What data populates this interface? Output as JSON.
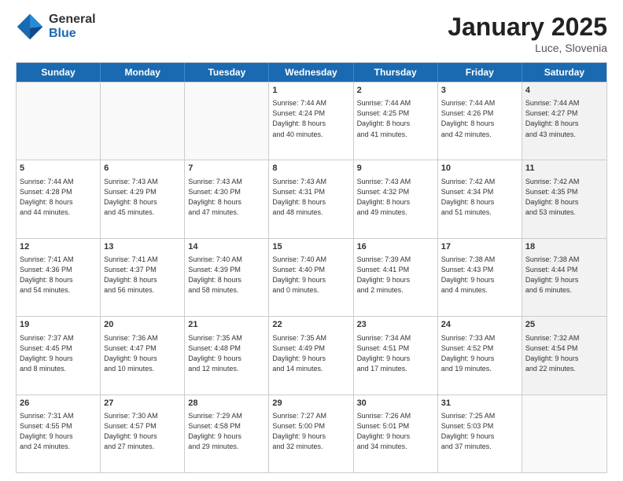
{
  "logo": {
    "general": "General",
    "blue": "Blue"
  },
  "title": {
    "month": "January 2025",
    "location": "Luce, Slovenia"
  },
  "header": {
    "days": [
      "Sunday",
      "Monday",
      "Tuesday",
      "Wednesday",
      "Thursday",
      "Friday",
      "Saturday"
    ]
  },
  "rows": [
    [
      {
        "day": "",
        "text": "",
        "empty": true
      },
      {
        "day": "",
        "text": "",
        "empty": true
      },
      {
        "day": "",
        "text": "",
        "empty": true
      },
      {
        "day": "1",
        "text": "Sunrise: 7:44 AM\nSunset: 4:24 PM\nDaylight: 8 hours\nand 40 minutes.",
        "empty": false
      },
      {
        "day": "2",
        "text": "Sunrise: 7:44 AM\nSunset: 4:25 PM\nDaylight: 8 hours\nand 41 minutes.",
        "empty": false
      },
      {
        "day": "3",
        "text": "Sunrise: 7:44 AM\nSunset: 4:26 PM\nDaylight: 8 hours\nand 42 minutes.",
        "empty": false
      },
      {
        "day": "4",
        "text": "Sunrise: 7:44 AM\nSunset: 4:27 PM\nDaylight: 8 hours\nand 43 minutes.",
        "empty": false,
        "shaded": true
      }
    ],
    [
      {
        "day": "5",
        "text": "Sunrise: 7:44 AM\nSunset: 4:28 PM\nDaylight: 8 hours\nand 44 minutes.",
        "empty": false
      },
      {
        "day": "6",
        "text": "Sunrise: 7:43 AM\nSunset: 4:29 PM\nDaylight: 8 hours\nand 45 minutes.",
        "empty": false
      },
      {
        "day": "7",
        "text": "Sunrise: 7:43 AM\nSunset: 4:30 PM\nDaylight: 8 hours\nand 47 minutes.",
        "empty": false
      },
      {
        "day": "8",
        "text": "Sunrise: 7:43 AM\nSunset: 4:31 PM\nDaylight: 8 hours\nand 48 minutes.",
        "empty": false
      },
      {
        "day": "9",
        "text": "Sunrise: 7:43 AM\nSunset: 4:32 PM\nDaylight: 8 hours\nand 49 minutes.",
        "empty": false
      },
      {
        "day": "10",
        "text": "Sunrise: 7:42 AM\nSunset: 4:34 PM\nDaylight: 8 hours\nand 51 minutes.",
        "empty": false
      },
      {
        "day": "11",
        "text": "Sunrise: 7:42 AM\nSunset: 4:35 PM\nDaylight: 8 hours\nand 53 minutes.",
        "empty": false,
        "shaded": true
      }
    ],
    [
      {
        "day": "12",
        "text": "Sunrise: 7:41 AM\nSunset: 4:36 PM\nDaylight: 8 hours\nand 54 minutes.",
        "empty": false
      },
      {
        "day": "13",
        "text": "Sunrise: 7:41 AM\nSunset: 4:37 PM\nDaylight: 8 hours\nand 56 minutes.",
        "empty": false
      },
      {
        "day": "14",
        "text": "Sunrise: 7:40 AM\nSunset: 4:39 PM\nDaylight: 8 hours\nand 58 minutes.",
        "empty": false
      },
      {
        "day": "15",
        "text": "Sunrise: 7:40 AM\nSunset: 4:40 PM\nDaylight: 9 hours\nand 0 minutes.",
        "empty": false
      },
      {
        "day": "16",
        "text": "Sunrise: 7:39 AM\nSunset: 4:41 PM\nDaylight: 9 hours\nand 2 minutes.",
        "empty": false
      },
      {
        "day": "17",
        "text": "Sunrise: 7:38 AM\nSunset: 4:43 PM\nDaylight: 9 hours\nand 4 minutes.",
        "empty": false
      },
      {
        "day": "18",
        "text": "Sunrise: 7:38 AM\nSunset: 4:44 PM\nDaylight: 9 hours\nand 6 minutes.",
        "empty": false,
        "shaded": true
      }
    ],
    [
      {
        "day": "19",
        "text": "Sunrise: 7:37 AM\nSunset: 4:45 PM\nDaylight: 9 hours\nand 8 minutes.",
        "empty": false
      },
      {
        "day": "20",
        "text": "Sunrise: 7:36 AM\nSunset: 4:47 PM\nDaylight: 9 hours\nand 10 minutes.",
        "empty": false
      },
      {
        "day": "21",
        "text": "Sunrise: 7:35 AM\nSunset: 4:48 PM\nDaylight: 9 hours\nand 12 minutes.",
        "empty": false
      },
      {
        "day": "22",
        "text": "Sunrise: 7:35 AM\nSunset: 4:49 PM\nDaylight: 9 hours\nand 14 minutes.",
        "empty": false
      },
      {
        "day": "23",
        "text": "Sunrise: 7:34 AM\nSunset: 4:51 PM\nDaylight: 9 hours\nand 17 minutes.",
        "empty": false
      },
      {
        "day": "24",
        "text": "Sunrise: 7:33 AM\nSunset: 4:52 PM\nDaylight: 9 hours\nand 19 minutes.",
        "empty": false
      },
      {
        "day": "25",
        "text": "Sunrise: 7:32 AM\nSunset: 4:54 PM\nDaylight: 9 hours\nand 22 minutes.",
        "empty": false,
        "shaded": true
      }
    ],
    [
      {
        "day": "26",
        "text": "Sunrise: 7:31 AM\nSunset: 4:55 PM\nDaylight: 9 hours\nand 24 minutes.",
        "empty": false
      },
      {
        "day": "27",
        "text": "Sunrise: 7:30 AM\nSunset: 4:57 PM\nDaylight: 9 hours\nand 27 minutes.",
        "empty": false
      },
      {
        "day": "28",
        "text": "Sunrise: 7:29 AM\nSunset: 4:58 PM\nDaylight: 9 hours\nand 29 minutes.",
        "empty": false
      },
      {
        "day": "29",
        "text": "Sunrise: 7:27 AM\nSunset: 5:00 PM\nDaylight: 9 hours\nand 32 minutes.",
        "empty": false
      },
      {
        "day": "30",
        "text": "Sunrise: 7:26 AM\nSunset: 5:01 PM\nDaylight: 9 hours\nand 34 minutes.",
        "empty": false
      },
      {
        "day": "31",
        "text": "Sunrise: 7:25 AM\nSunset: 5:03 PM\nDaylight: 9 hours\nand 37 minutes.",
        "empty": false
      },
      {
        "day": "",
        "text": "",
        "empty": true,
        "shaded": true
      }
    ]
  ]
}
